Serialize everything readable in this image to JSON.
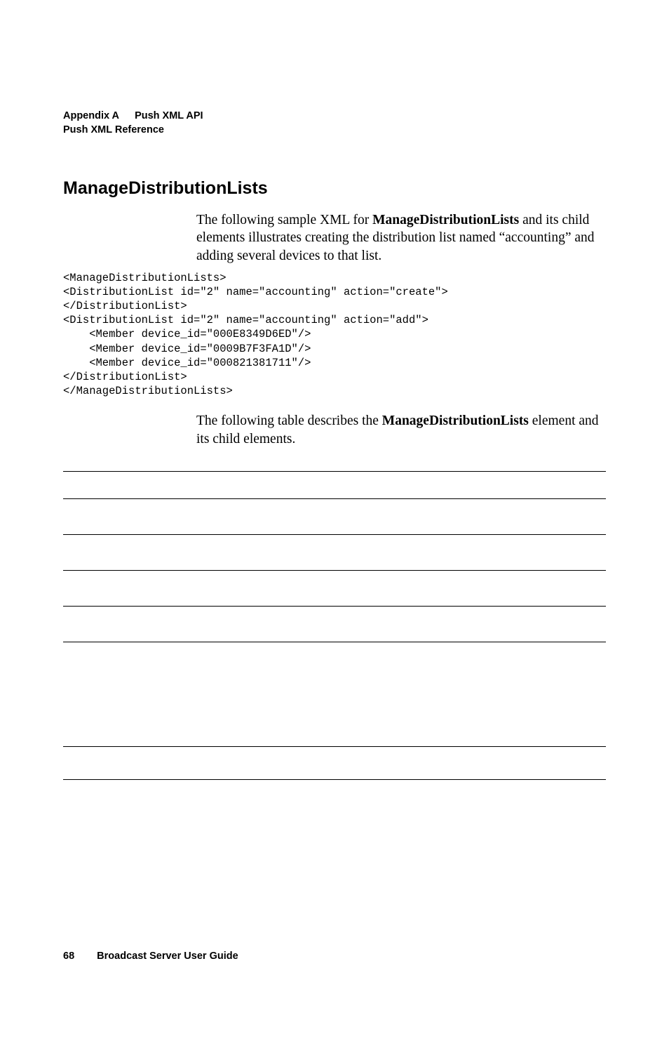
{
  "header": {
    "appendix_label": "Appendix A",
    "appendix_title": "Push XML API",
    "sub_title": "Push XML Reference"
  },
  "section": {
    "title": "ManageDistributionLists",
    "intro_pre": "The following sample XML for ",
    "intro_bold": "ManageDistributionLists",
    "intro_post": " and its child elements illustrates creating the distribution list named “accounting” and adding several devices to that list."
  },
  "code": "<ManageDistributionLists>\n<DistributionList id=\"2\" name=\"accounting\" action=\"create\">\n</DistributionList>\n<DistributionList id=\"2\" name=\"accounting\" action=\"add\">\n    <Member device_id=\"000E8349D6ED\"/>\n    <Member device_id=\"0009B7F3FA1D\"/>\n    <Member device_id=\"000821381711\"/>\n</DistributionList>\n</ManageDistributionLists>",
  "followup": {
    "pre": "The following table describes the ",
    "bold": "ManageDistributionLists",
    "post": " element and its child elements."
  },
  "footer": {
    "page": "68",
    "title": "Broadcast Server User Guide"
  }
}
